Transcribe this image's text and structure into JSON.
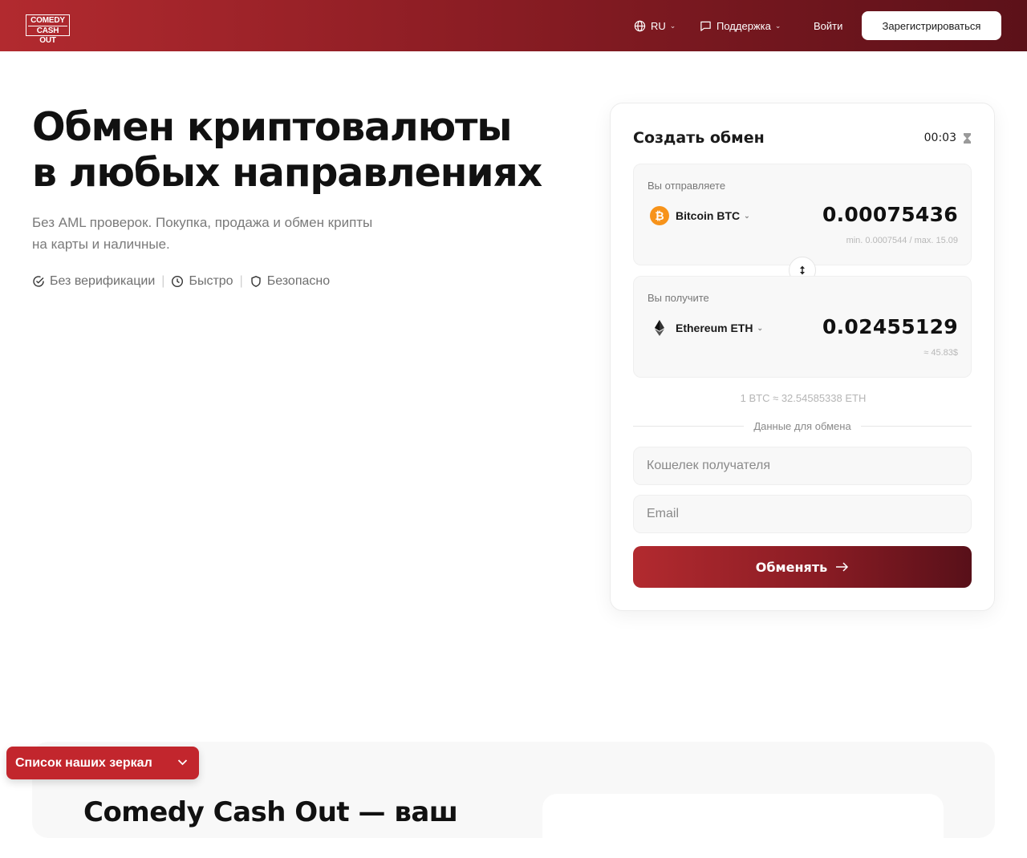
{
  "header": {
    "logo": {
      "line1": "COMEDY",
      "line2": "CASH OUT"
    },
    "lang": "RU",
    "support": "Поддержка",
    "login": "Войти",
    "register": "Зарегистрироваться"
  },
  "hero": {
    "title_line1": "Обмен криптовалюты",
    "title_line2": "в любых направлениях",
    "subtitle": "Без AML проверок. Покупка, продажа и обмен крипты на карты и наличные.",
    "features": [
      "Без верификации",
      "Быстро",
      "Безопасно"
    ]
  },
  "exchange": {
    "title": "Создать обмен",
    "timer": "00:03",
    "send": {
      "label": "Вы отправляете",
      "coin": "Bitcoin BTC",
      "amount": "0.00075436",
      "limits": "min. 0.0007544 / max. 15.09"
    },
    "receive": {
      "label": "Вы получите",
      "coin": "Ethereum ETH",
      "amount": "0.02455129",
      "usd": "≈ 45.83$"
    },
    "rate": "1 BTC ≈ 32.54585338 ETH",
    "details_label": "Данные для обмена",
    "wallet_placeholder": "Кошелек получателя",
    "email_placeholder": "Email",
    "submit": "Обменять"
  },
  "section2": {
    "title": "Comedy Cash Out — ваш"
  },
  "mirrors": {
    "label": "Список наших зеркал"
  },
  "colors": {
    "brand_red": "#b22a2f",
    "brand_dark": "#5c1119",
    "btc_orange": "#f7931a"
  }
}
